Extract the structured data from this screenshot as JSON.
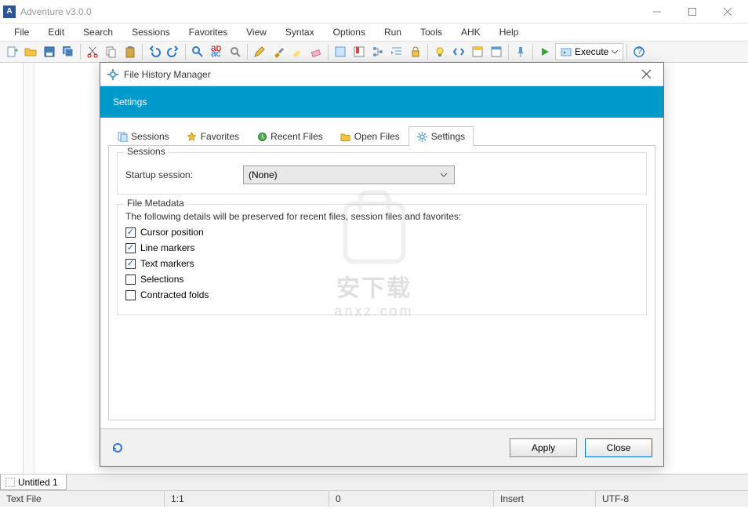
{
  "window": {
    "title": "Adventure v3.0.0"
  },
  "menu": [
    "File",
    "Edit",
    "Search",
    "Sessions",
    "Favorites",
    "View",
    "Syntax",
    "Options",
    "Run",
    "Tools",
    "AHK",
    "Help"
  ],
  "toolbar": {
    "execute_label": "Execute"
  },
  "filetab": {
    "name": "Untitled 1"
  },
  "statusbar": {
    "type": "Text File",
    "pos": "1:1",
    "len": "0",
    "mode": "Insert",
    "enc": "UTF-8"
  },
  "dialog": {
    "title": "File History Manager",
    "header": "Settings",
    "tabs": [
      "Sessions",
      "Favorites",
      "Recent Files",
      "Open Files",
      "Settings"
    ],
    "sessions_group": {
      "legend": "Sessions",
      "startup_label": "Startup session:",
      "startup_value": "(None)"
    },
    "meta_group": {
      "legend": "File Metadata",
      "desc": "The following details will be preserved for recent files, session files and favorites:",
      "items": [
        {
          "label": "Cursor position",
          "checked": true
        },
        {
          "label": "Line markers",
          "checked": true
        },
        {
          "label": "Text markers",
          "checked": true
        },
        {
          "label": "Selections",
          "checked": false
        },
        {
          "label": "Contracted folds",
          "checked": false
        }
      ]
    },
    "buttons": {
      "apply": "Apply",
      "close": "Close"
    }
  },
  "watermark": {
    "line1": "安下载",
    "line2": "anxz.com"
  }
}
